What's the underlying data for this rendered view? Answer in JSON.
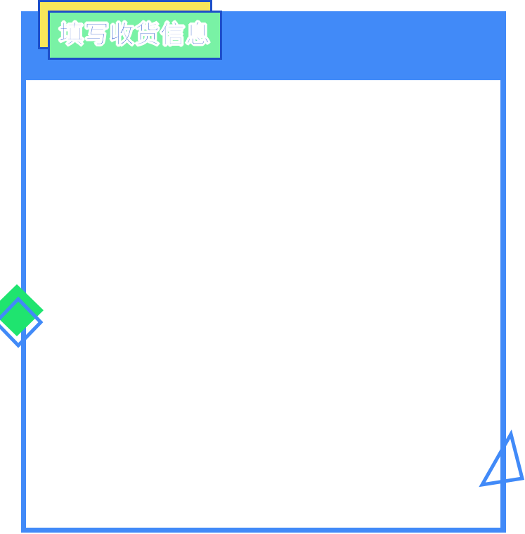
{
  "card": {
    "title": "填写收货信息"
  },
  "decorations": {
    "left_diamond": {
      "fill_color": "#1fe46f",
      "outline_color": "#418af8"
    },
    "right_triangle": {
      "outline_color": "#418af8"
    }
  },
  "colors": {
    "accent": "#418af8",
    "title_front": "#79f2a5",
    "title_back": "#f8e65a",
    "title_outline": "#1d4fc9",
    "background": "#ffffff"
  }
}
